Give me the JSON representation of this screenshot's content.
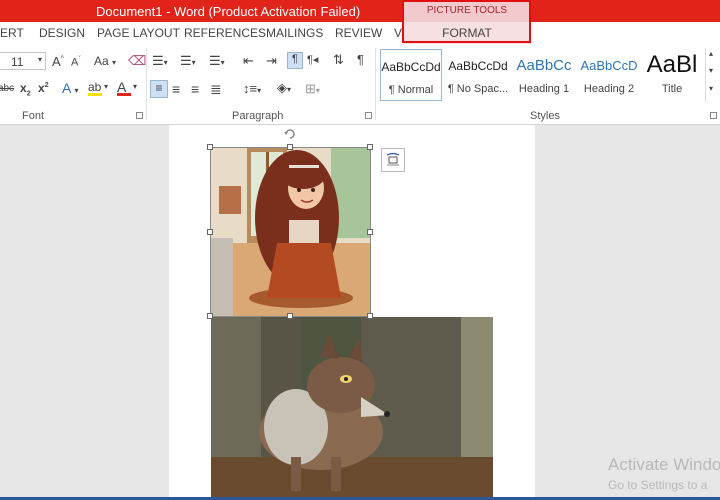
{
  "title_bar": {
    "document_title": "Document1 -  Word (Product Activation Failed)",
    "context_group_label": "PICTURE TOOLS"
  },
  "tabs": [
    {
      "label": "ERT"
    },
    {
      "label": "DESIGN"
    },
    {
      "label": "PAGE LAYOUT"
    },
    {
      "label": "REFERENCES"
    },
    {
      "label": "MAILINGS"
    },
    {
      "label": "REVIEW"
    },
    {
      "label": "VIEW"
    }
  ],
  "format_tab": {
    "label": "FORMAT"
  },
  "font_group": {
    "font_size": "11",
    "grow_label": "A",
    "shrink_label": "A",
    "change_case_label": "Aa",
    "strikethrough_label": "abc",
    "subscript_label": "x",
    "superscript_label": "x",
    "sub_index": "2",
    "sup_index": "2",
    "text_effects_label": "A",
    "font_color_label": "A",
    "group_label": "Font"
  },
  "paragraph_group": {
    "group_label": "Paragraph",
    "pilcrow": "¶"
  },
  "styles_group": {
    "group_label": "Styles",
    "items": [
      {
        "sample": "AaBbCcDd",
        "name": "¶ Normal"
      },
      {
        "sample": "AaBbCcDd",
        "name": "¶ No Spac..."
      },
      {
        "sample": "AaBbCc",
        "name": "Heading 1"
      },
      {
        "sample": "AaBbCcD",
        "name": "Heading 2"
      },
      {
        "sample": "AaBl",
        "name": "Title"
      }
    ]
  },
  "watermark": {
    "line1": "Activate Windo",
    "line2": "Go to Settings to a"
  },
  "colors": {
    "titlebar": "#e2231a",
    "context_tab": "#f2c9cd",
    "outline": "#e01010",
    "highlight": "#f5e400",
    "font_color": "#e0251b"
  }
}
